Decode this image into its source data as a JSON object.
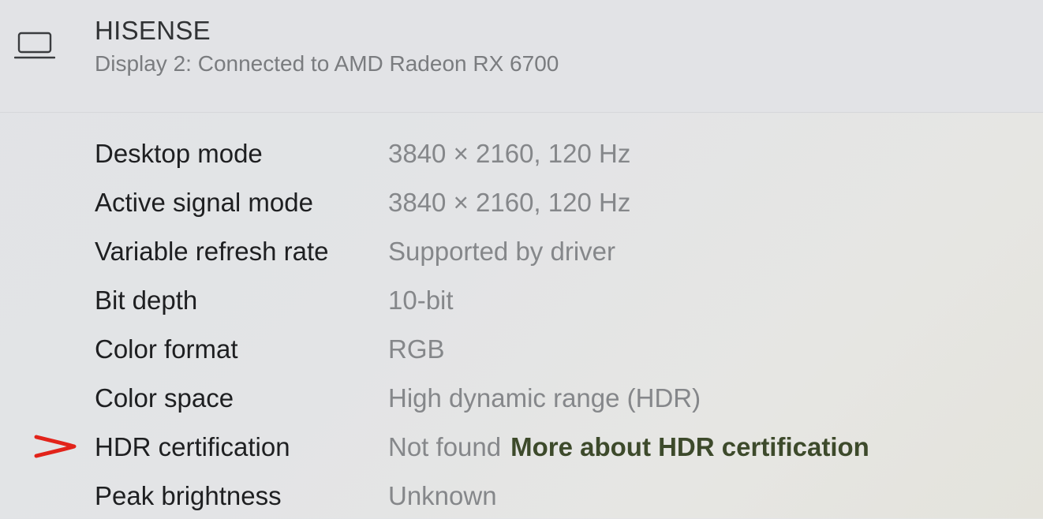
{
  "header": {
    "display_name": "HISENSE",
    "subtitle": "Display 2: Connected to AMD Radeon RX 6700",
    "icon": "monitor-icon"
  },
  "rows": [
    {
      "label": "Desktop mode",
      "value": "3840 × 2160, 120 Hz"
    },
    {
      "label": "Active signal mode",
      "value": "3840 × 2160, 120 Hz"
    },
    {
      "label": "Variable refresh rate",
      "value": "Supported by driver"
    },
    {
      "label": "Bit depth",
      "value": "10-bit"
    },
    {
      "label": "Color format",
      "value": "RGB"
    },
    {
      "label": "Color space",
      "value": "High dynamic range (HDR)"
    },
    {
      "label": "HDR certification",
      "value": "Not found",
      "link": "More about HDR certification"
    },
    {
      "label": "Peak brightness",
      "value": "Unknown"
    }
  ],
  "annotation": {
    "icon": "red-arrow-marker-icon",
    "color": "#e2231a"
  },
  "colors": {
    "label": "#1e1f21",
    "value": "#85878a",
    "link": "#3d4a2b"
  }
}
